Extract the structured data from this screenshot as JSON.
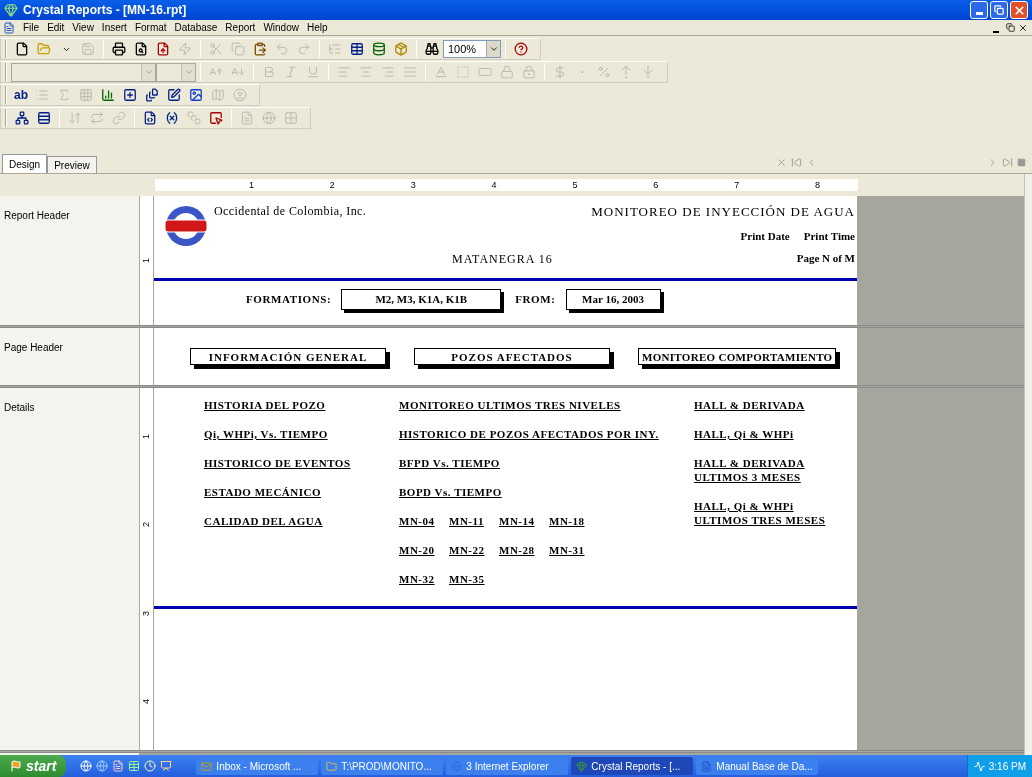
{
  "window": {
    "title": "Crystal Reports - [MN-16.rpt]"
  },
  "menu": [
    "File",
    "Edit",
    "View",
    "Insert",
    "Format",
    "Database",
    "Report",
    "Window",
    "Help"
  ],
  "toolbars": [
    [
      {
        "kind": "new",
        "disabled": false
      },
      {
        "kind": "open",
        "disabled": false
      },
      {
        "kind": "caret",
        "disabled": false
      },
      {
        "kind": "save",
        "disabled": true
      },
      {
        "kind": "separator"
      },
      {
        "kind": "print",
        "disabled": false
      },
      {
        "kind": "preview",
        "disabled": false
      },
      {
        "kind": "export",
        "disabled": false
      },
      {
        "kind": "refresh",
        "disabled": true
      },
      {
        "kind": "separator"
      },
      {
        "kind": "cut",
        "disabled": true
      },
      {
        "kind": "copy",
        "disabled": true
      },
      {
        "kind": "paste",
        "disabled": false
      },
      {
        "kind": "undo",
        "disabled": true
      },
      {
        "kind": "redo",
        "disabled": true
      },
      {
        "kind": "separator"
      },
      {
        "kind": "tree",
        "disabled": true
      },
      {
        "kind": "table",
        "disabled": false
      },
      {
        "kind": "database",
        "disabled": false
      },
      {
        "kind": "toolbox",
        "disabled": false
      },
      {
        "kind": "separator"
      },
      {
        "kind": "find",
        "disabled": false
      },
      {
        "kind": "zoom",
        "value": "100%"
      },
      {
        "kind": "separator"
      },
      {
        "kind": "help",
        "disabled": false
      }
    ],
    [
      {
        "kind": "font",
        "disabled": true
      },
      {
        "kind": "size",
        "disabled": true
      },
      {
        "kind": "separator"
      },
      {
        "kind": "grow",
        "disabled": true
      },
      {
        "kind": "shrink",
        "disabled": true
      },
      {
        "kind": "separator"
      },
      {
        "kind": "bold",
        "disabled": true
      },
      {
        "kind": "italic",
        "disabled": true
      },
      {
        "kind": "underline",
        "disabled": true
      },
      {
        "kind": "separator"
      },
      {
        "kind": "align-left",
        "disabled": true
      },
      {
        "kind": "align-center",
        "disabled": true
      },
      {
        "kind": "align-right",
        "disabled": true
      },
      {
        "kind": "justify",
        "disabled": true
      },
      {
        "kind": "separator"
      },
      {
        "kind": "font-color",
        "disabled": true
      },
      {
        "kind": "border",
        "disabled": true
      },
      {
        "kind": "suppress",
        "disabled": true
      },
      {
        "kind": "lock",
        "disabled": true
      },
      {
        "kind": "lock-size",
        "disabled": true
      },
      {
        "kind": "separator"
      },
      {
        "kind": "currency",
        "disabled": true
      },
      {
        "kind": "comma",
        "disabled": true
      },
      {
        "kind": "percent",
        "disabled": true
      },
      {
        "kind": "decimal-add",
        "disabled": true
      },
      {
        "kind": "decimal-remove",
        "disabled": true
      }
    ],
    [
      {
        "kind": "text-object",
        "label": "ab",
        "disabled": false
      },
      {
        "kind": "group",
        "disabled": true
      },
      {
        "kind": "sum",
        "disabled": true
      },
      {
        "kind": "crosstab",
        "disabled": true
      },
      {
        "kind": "chart",
        "disabled": false
      },
      {
        "kind": "ole",
        "disabled": false
      },
      {
        "kind": "subreport",
        "disabled": false
      },
      {
        "kind": "box",
        "disabled": false
      },
      {
        "kind": "picture",
        "disabled": false
      },
      {
        "kind": "map",
        "disabled": true
      },
      {
        "kind": "person",
        "disabled": true
      }
    ],
    [
      {
        "kind": "relations",
        "disabled": false
      },
      {
        "kind": "sections",
        "disabled": false
      },
      {
        "kind": "separator"
      },
      {
        "kind": "sort",
        "disabled": true
      },
      {
        "kind": "swap",
        "disabled": true
      },
      {
        "kind": "link",
        "disabled": true
      },
      {
        "kind": "separator"
      },
      {
        "kind": "formula",
        "disabled": false
      },
      {
        "kind": "x1",
        "disabled": false
      },
      {
        "kind": "param",
        "disabled": true
      },
      {
        "kind": "select",
        "disabled": false
      },
      {
        "kind": "separator"
      },
      {
        "kind": "sql",
        "disabled": true
      },
      {
        "kind": "globe",
        "disabled": true
      },
      {
        "kind": "pattern",
        "disabled": true
      }
    ]
  ],
  "tabs": [
    {
      "label": "Design",
      "selected": true
    },
    {
      "label": "Preview",
      "selected": false
    }
  ],
  "ruler": [
    "1",
    "2",
    "3",
    "4",
    "5",
    "6",
    "7",
    "8"
  ],
  "sections": [
    {
      "kind": "report-header",
      "name": "Report Header",
      "ruler": [
        "1"
      ],
      "company": "Occidental de Colombia, Inc.",
      "title": "MONITOREO DE INYECCIÓN DE AGUA",
      "print_date": "Print Date",
      "print_time": "Print Time",
      "field": "MATANEGRA 16",
      "page": "Page N of M",
      "filters": [
        {
          "label": "FORMATIONS:",
          "value": "M2, M3, K1A, K1B"
        },
        {
          "label": "FROM:",
          "value": "Mar 16, 2003"
        }
      ]
    },
    {
      "kind": "page-header",
      "name": "Page Header",
      "buttons": [
        "INFORMACIÓN GENERAL",
        "POZOS AFECTADOS",
        "MONITOREO COMPORTAMIENTO"
      ]
    },
    {
      "kind": "details",
      "name": "Details",
      "ruler": [
        "1",
        "2",
        "3",
        "4"
      ],
      "column_1": [
        [
          "HISTORIA DEL POZO"
        ],
        [
          "Qi, WHPi, Vs. TIEMPO"
        ],
        [
          "HISTORICO DE EVENTOS"
        ],
        [
          "ESTADO MECÁNICO"
        ],
        [
          "CALIDAD DEL AGUA"
        ]
      ],
      "column_2": [
        [
          "MONITOREO ULTIMOS TRES NIVELES"
        ],
        [
          "HISTORICO DE POZOS AFECTADOS POR INY."
        ],
        [
          "BFPD Vs. TIEMPO"
        ],
        [
          "BOPD Vs. TIEMPO"
        ]
      ],
      "wells": [
        "MN-04",
        "MN-11",
        "MN-14",
        "MN-18",
        "MN-20",
        "MN-22",
        "MN-28",
        "MN-31",
        "MN-32",
        "MN-35"
      ],
      "column_3": [
        [
          "HALL & DERIVADA"
        ],
        [
          "HALL, Qi & WHPi"
        ],
        [
          "HALL & DERIVADA",
          "ULTIMOS 3 MESES"
        ],
        [
          "HALL, Qi & WHPi",
          "ULTIMOS TRES MESES"
        ]
      ]
    }
  ],
  "taskbar": {
    "start": "start",
    "tasks": [
      {
        "label": "Inbox - Microsoft ...",
        "kind": "mail",
        "selected": false
      },
      {
        "label": "T:\\PROD\\MONITO...",
        "kind": "folder",
        "selected": false
      },
      {
        "label": "3 Internet Explorer",
        "kind": "browser",
        "selected": false
      },
      {
        "label": "Crystal Reports - [...",
        "kind": "crystal",
        "selected": true
      },
      {
        "label": "Manual Base de Da...",
        "kind": "document",
        "selected": false
      }
    ],
    "clock": "3:16 PM"
  }
}
